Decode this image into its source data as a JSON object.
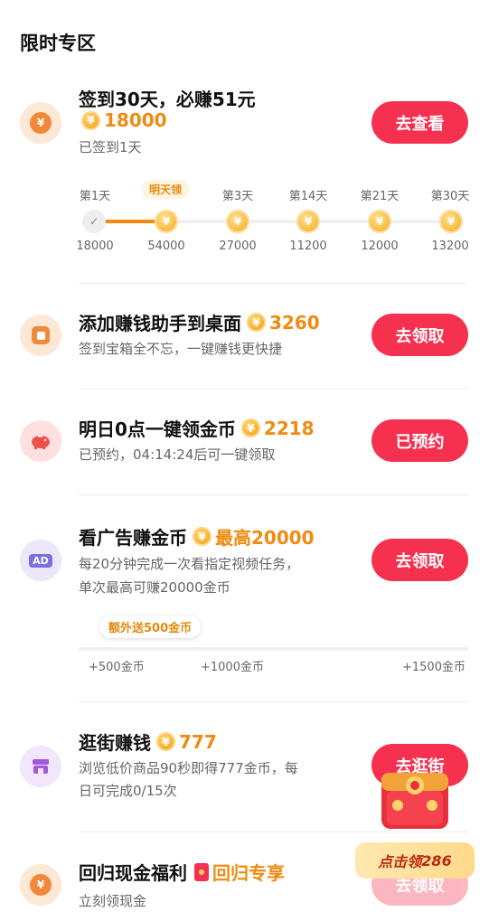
{
  "section_title": "限时专区",
  "checkin": {
    "title": "签到30天，必赚51元",
    "reward": "18000",
    "status": "已签到1天",
    "button": "去查看",
    "tomorrow_badge": "明天领",
    "days": [
      {
        "label": "第1天",
        "amount": "18000"
      },
      {
        "label": "",
        "amount": "54000"
      },
      {
        "label": "第3天",
        "amount": "27000"
      },
      {
        "label": "第14天",
        "amount": "11200"
      },
      {
        "label": "第21天",
        "amount": "12000"
      },
      {
        "label": "第30天",
        "amount": "13200"
      }
    ]
  },
  "desktop": {
    "title": "添加赚钱助手到桌面",
    "reward": "3260",
    "desc": "签到宝箱全不忘，一键赚钱更快捷",
    "button": "去领取"
  },
  "tomorrow": {
    "title": "明日0点一键领金币",
    "reward": "2218",
    "desc": "已预约，04:14:24后可一键领取",
    "button": "已预约"
  },
  "ads": {
    "title": "看广告赚金币",
    "reward": "最高20000",
    "desc_line1": "每20分钟完成一次看指定视频任务，",
    "desc_line2": "单次最高可赚20000金币",
    "button": "去领取",
    "extra_badge": "额外送500金币",
    "milestones": [
      "+500金币",
      "+1000金币",
      "+1500金币"
    ],
    "icon_text": "AD"
  },
  "shopping": {
    "title": "逛街赚钱",
    "reward": "777",
    "desc_line1": "浏览低价商品90秒即得777金币，每",
    "desc_line2": "日可完成0/15次",
    "button": "去逛街"
  },
  "return": {
    "title": "回归现金福利",
    "tag": "回归专享",
    "desc": "立刻领现金",
    "button": "去领取"
  },
  "floating": {
    "prefix": "点击领",
    "amount": "286"
  },
  "coin_symbol": "¥",
  "colors": {
    "accent": "#f5314f",
    "reward": "#f08a10"
  }
}
